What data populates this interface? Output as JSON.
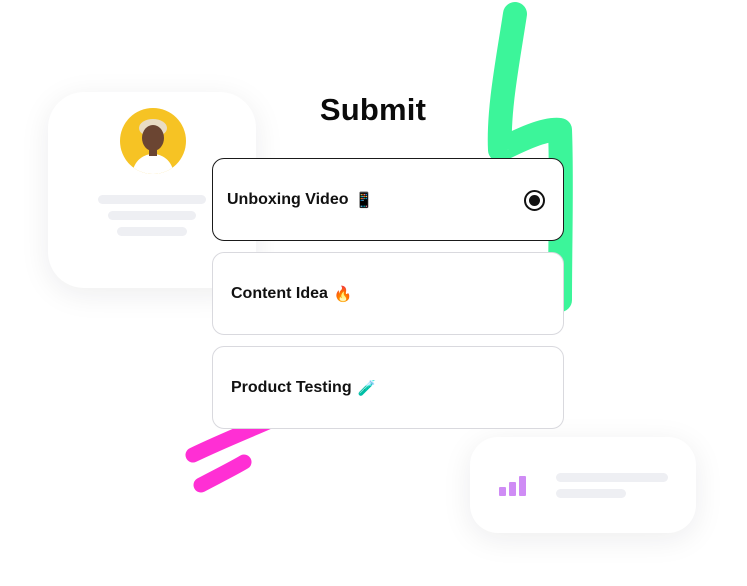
{
  "form": {
    "title": "Submit",
    "options": [
      {
        "label": "Unboxing Video",
        "emoji": "📱",
        "selected": true
      },
      {
        "label": "Content Idea",
        "emoji": "🔥",
        "selected": false
      },
      {
        "label": "Product Testing",
        "emoji": "🧪",
        "selected": false
      }
    ]
  },
  "colors": {
    "accent_green": "#3cf59a",
    "accent_magenta": "#ff2fd4",
    "avatar_bg": "#f6c324",
    "stats_bars": "#cf8cf5"
  },
  "icons": {
    "radio": "radio-selected-icon",
    "stats": "bar-chart-icon"
  }
}
